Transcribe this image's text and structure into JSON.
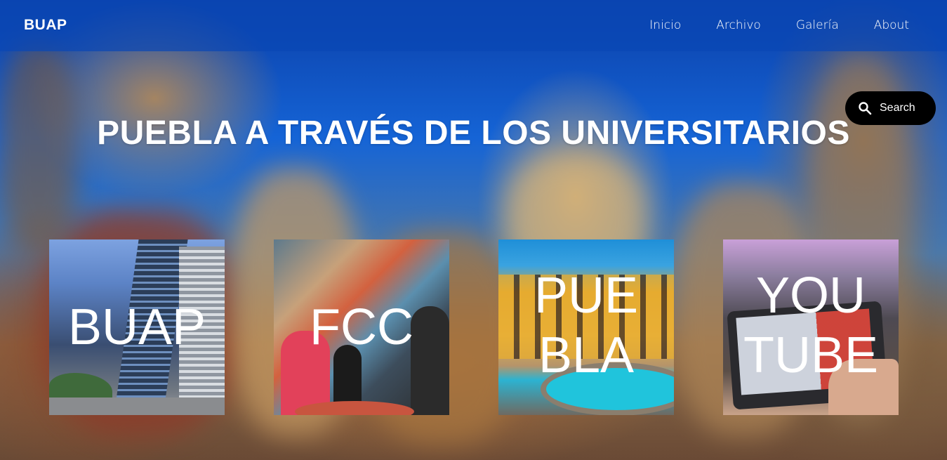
{
  "navbar": {
    "brand": "BUAP",
    "links": [
      "Inicio",
      "Archivo",
      "Galería",
      "About"
    ]
  },
  "search": {
    "label": "Search",
    "icon": "search-icon"
  },
  "hero": {
    "title": "PUEBLA A TRAVÉS DE LOS UNIVERSITARIOS"
  },
  "cards": [
    {
      "lines": [
        "BUAP"
      ]
    },
    {
      "lines": [
        "FCC"
      ]
    },
    {
      "lines": [
        "PUE",
        "BLA"
      ]
    },
    {
      "lines": [
        "YOU",
        "TUBE"
      ]
    }
  ]
}
